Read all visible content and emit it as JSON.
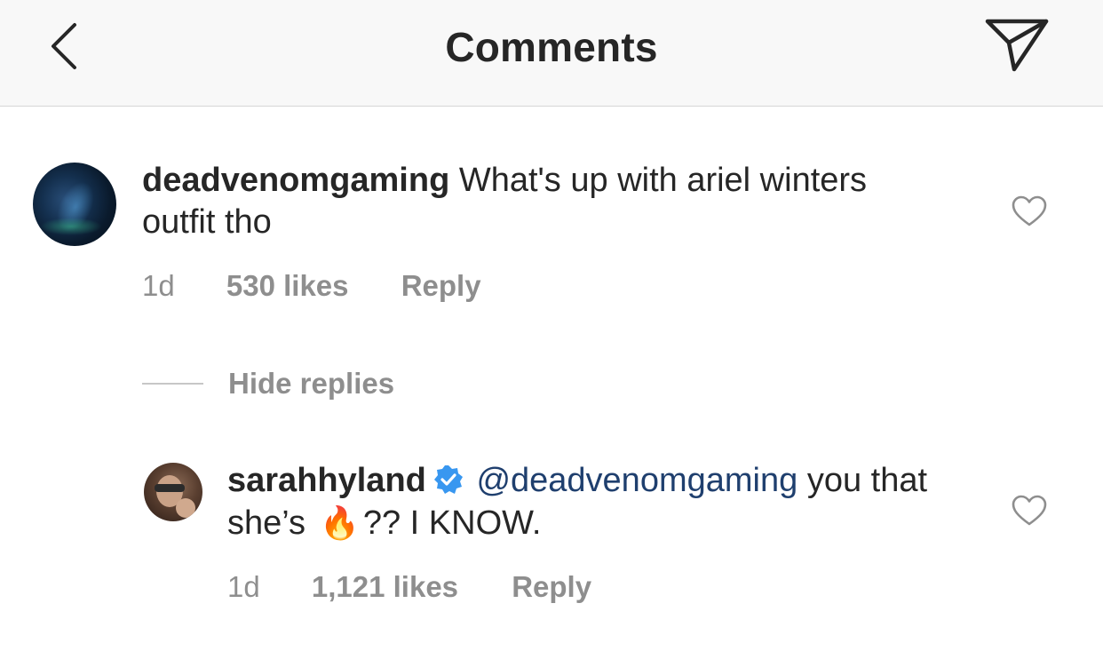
{
  "header": {
    "title": "Comments",
    "back_icon": "chevron-left-icon",
    "send_icon": "paper-plane-icon",
    "background": "#f8f8f8"
  },
  "comments": [
    {
      "username": "deadvenomgaming",
      "text": "What's up with ariel winters outfit tho",
      "time": "1d",
      "likes": "530 likes",
      "reply_label": "Reply",
      "like_icon": "heart-outline-icon"
    }
  ],
  "replies_toggle": {
    "label": "Hide replies"
  },
  "replies": [
    {
      "username": "sarahhyland",
      "verified": true,
      "verified_icon": "verified-badge-icon",
      "mention": "@deadvenomgaming",
      "text_before_emoji": "you that she’s",
      "emoji": "🔥",
      "text_after_emoji": "?? I KNOW.",
      "time": "1d",
      "likes": "1,121 likes",
      "reply_label": "Reply",
      "like_icon": "heart-outline-icon"
    }
  ],
  "colors": {
    "text": "#262626",
    "secondary": "#8e8e8e",
    "mention": "#1f3f6e",
    "verified": "#3897f0"
  }
}
